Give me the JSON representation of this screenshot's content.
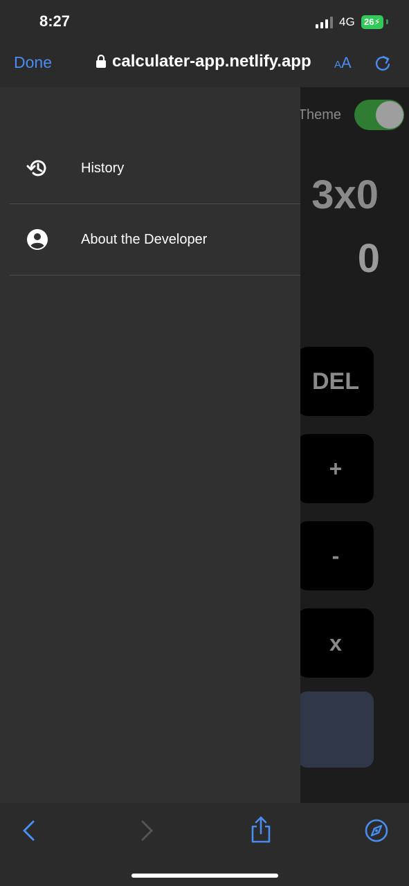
{
  "status": {
    "time": "8:27",
    "network": "4G",
    "battery": "26"
  },
  "browser": {
    "done_label": "Done",
    "url": "calculater-app.netlify.app",
    "text_size_label_small": "A",
    "text_size_label_large": "A"
  },
  "calculator": {
    "theme_label": "Theme",
    "expression": "3x0",
    "result": "0",
    "keys": {
      "del": "DEL",
      "plus": "+",
      "minus": "-",
      "times": "x"
    }
  },
  "drawer": {
    "items": [
      {
        "label": "History",
        "icon": "history-icon"
      },
      {
        "label": "About the Developer",
        "icon": "account-circle-icon"
      }
    ]
  },
  "toolbar": {
    "icons": [
      "back-icon",
      "forward-icon",
      "share-icon",
      "compass-icon"
    ]
  },
  "colors": {
    "accent": "#4a8cf0",
    "toggle_on": "#2f7d32",
    "drawer_bg": "#303030",
    "page_bg": "#1c1c1c"
  }
}
